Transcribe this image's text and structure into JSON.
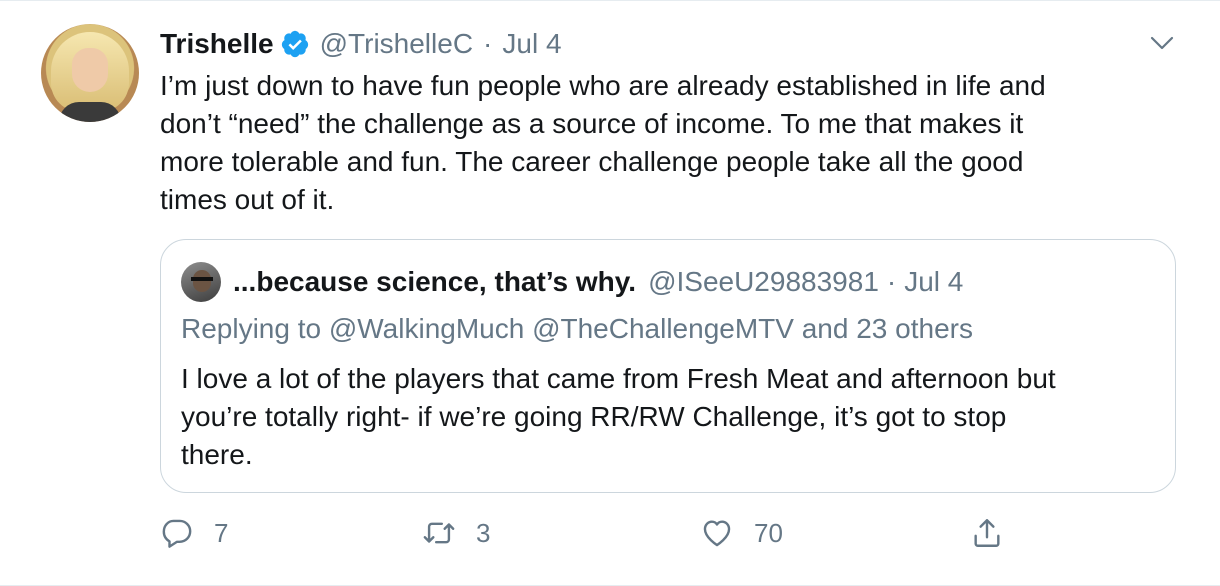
{
  "tweet": {
    "display_name": "Trishelle",
    "handle": "@TrishelleC",
    "separator": "·",
    "date": "Jul 4",
    "text": "I’m just down to have fun people who are already established in life and\ndon’t “need” the challenge as a source of income. To me that makes it\nmore tolerable and fun. The career challenge people take all the good\ntimes out of it."
  },
  "quote": {
    "display_name": "...because science, that’s why.",
    "handle": "@ISeeU29883981",
    "separator": "·",
    "date": "Jul 4",
    "replying_to": "Replying to @WalkingMuch @TheChallengeMTV and 23 others",
    "text": "I love a lot of the players that came from Fresh Meat and afternoon but\nyou’re totally right- if we’re going RR/RW Challenge, it’s got to stop\nthere."
  },
  "actions": {
    "reply_count": "7",
    "retweet_count": "3",
    "like_count": "70"
  },
  "icons": {
    "verified": "verified-badge-icon",
    "menu": "chevron-down-icon",
    "reply": "reply-icon",
    "retweet": "retweet-icon",
    "like": "heart-icon",
    "share": "share-icon"
  },
  "colors": {
    "accent": "#1da1f2",
    "secondary_text": "#657786",
    "border": "#ccd6dd"
  }
}
